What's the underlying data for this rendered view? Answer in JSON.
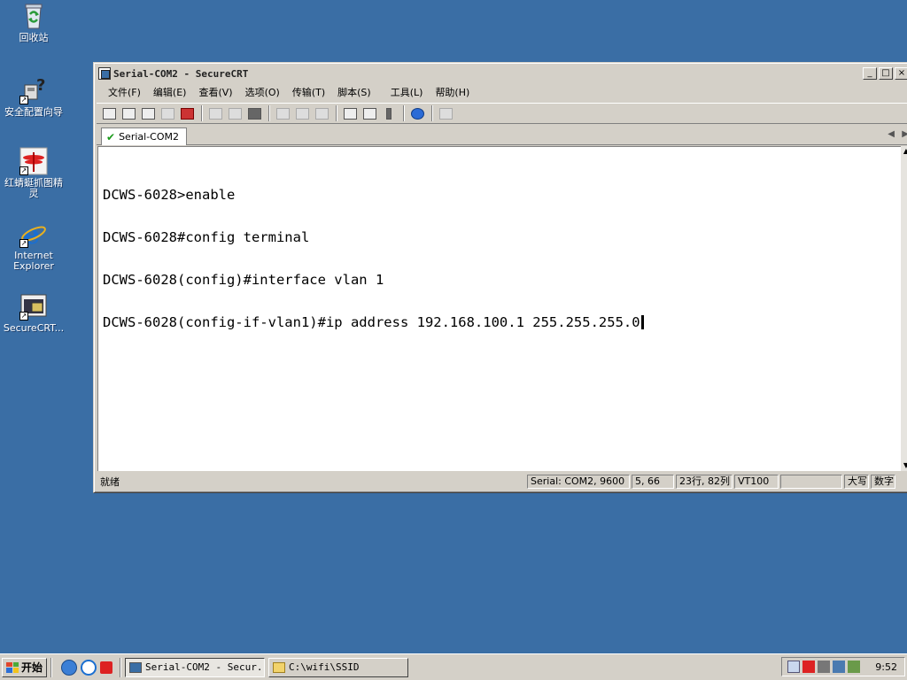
{
  "desktop": {
    "icons": [
      {
        "label": "回收站",
        "icon": "recycle-bin-icon"
      },
      {
        "label": "安全配置向导",
        "icon": "security-wizard-icon"
      },
      {
        "label": "红蜻蜓抓图精灵",
        "icon": "dragonfly-capture-icon"
      },
      {
        "label": "Internet Explorer",
        "icon": "ie-icon"
      },
      {
        "label": "SecureCRT...",
        "icon": "securecrt-icon"
      }
    ]
  },
  "window": {
    "title": "Serial-COM2 - SecureCRT",
    "controls": {
      "minimize": "_",
      "maximize": "□",
      "close": "×"
    },
    "menu": [
      "文件(F)",
      "编辑(E)",
      "查看(V)",
      "选项(O)",
      "传输(T)",
      "脚本(S)",
      "工具(L)",
      "帮助(H)"
    ],
    "tab": {
      "label": "Serial-COM2"
    },
    "terminal": {
      "lines": [
        "DCWS-6028>enable",
        "DCWS-6028#config terminal",
        "DCWS-6028(config)#interface vlan 1",
        "DCWS-6028(config-if-vlan1)#ip address 192.168.100.1 255.255.255.0"
      ]
    },
    "status": {
      "ready": "就绪",
      "connection": "Serial: COM2, 9600",
      "cursor_pos": "5, 66",
      "size": "23行, 82列",
      "emulation": "VT100",
      "blank": "",
      "caps": "大写",
      "num": "数字"
    }
  },
  "taskbar": {
    "start_label": "开始",
    "tasks": [
      {
        "label": "Serial-COM2 - Secur...",
        "active": true
      },
      {
        "label": "C:\\wifi\\SSID",
        "active": false
      }
    ],
    "clock": "9:52"
  },
  "colors": {
    "desktop": "#3a6ea5",
    "window_face": "#d4d0c8",
    "terminal_bg": "#ffffff"
  }
}
